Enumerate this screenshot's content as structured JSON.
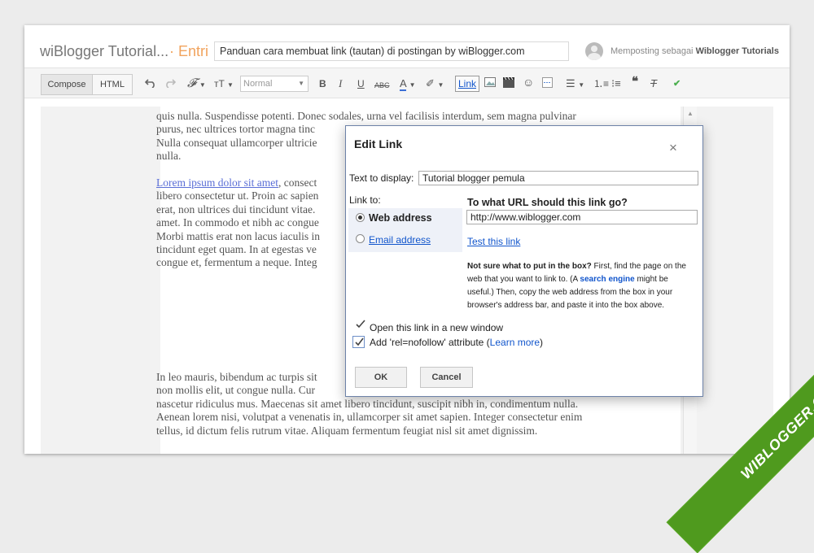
{
  "header": {
    "blog_name": "wiBlogger Tutorial...",
    "entry_label": "· Entri",
    "post_title": "Panduan cara membuat link (tautan) di postingan by wiBlogger.com",
    "posting_prefix": "Memposting sebagai",
    "posting_user": "Wiblogger Tutorials"
  },
  "toolbar": {
    "compose_label": "Compose",
    "html_label": "HTML",
    "font_size_select": "Normal",
    "link_label": "Link",
    "icons": [
      "undo-icon",
      "redo-icon",
      "font-family-icon",
      "font-size-icon",
      "bold-icon",
      "italic-icon",
      "underline-icon",
      "strikethrough-icon",
      "text-color-icon",
      "highlight-icon",
      "link-icon",
      "image-icon",
      "video-icon",
      "emoji-icon",
      "jump-break-icon",
      "align-icon",
      "numbered-list-icon",
      "bullet-list-icon",
      "quote-icon",
      "clear-format-icon",
      "spellcheck-icon"
    ]
  },
  "editor": {
    "para1": [
      "quis nulla. Suspendisse potenti. Donec sodales, urna vel facilisis interdum, sem magna pulvinar",
      "purus, nec ultrices tortor magna tinc",
      "Nulla consequat ullamcorper ultricie",
      "nulla."
    ],
    "para2_link": "Lorem ipsum dolor sit amet",
    "para2_first_rest": ", consect",
    "para2": [
      "libero consectetur ut. Proin ac sapien",
      "erat, non ultrices dui tincidunt vitae.",
      "amet. In commodo et nibh ac congue",
      "Morbi mattis erat non lacus iaculis in",
      "tincidunt eget quam. In at egestas ve",
      "congue et, fermentum a neque. Integ"
    ],
    "para3": [
      "In leo mauris, bibendum ac turpis sit",
      "non mollis elit, ut congue nulla. Cur",
      "nascetur ridiculus mus. Maecenas sit amet libero tincidunt, suscipit nibh in, condimentum nulla.",
      "Aenean lorem nisi, volutpat a venenatis in, ullamcorper sit amet sapien. Integer consectetur enim",
      "tellus, id dictum felis rutrum vitae. Aliquam fermentum feugiat nisl sit amet dignissim."
    ]
  },
  "dialog": {
    "title": "Edit Link",
    "close": "×",
    "text_to_display_label": "Text to display:",
    "text_to_display_value": "Tutorial blogger pemula",
    "link_to_label": "Link to:",
    "web_address": "Web address",
    "email_address": "Email address",
    "url_question": "To what URL should this link go?",
    "url_value": "http://www.wiblogger.com",
    "test_link": "Test this link",
    "help_bold": "Not sure what to put in the box?",
    "help_1": " First, find the page on the web that you want to link to. (A ",
    "help_link": "search engine",
    "help_2": " might be useful.) Then, copy the web address from the box in your browser's address bar, and paste it into the box above.",
    "open_new_window": "Open this link in a new window",
    "nofollow_prefix": "Add 'rel=nofollow' attribute (",
    "learn_more": "Learn more",
    "nofollow_suffix": ")",
    "ok": "OK",
    "cancel": "Cancel"
  },
  "watermark": "WIBLOGGER.COM",
  "colors": {
    "accent_orange": "#f1a35d",
    "link_blue": "#1155cc",
    "ribbon_green": "#4f9a1e"
  }
}
